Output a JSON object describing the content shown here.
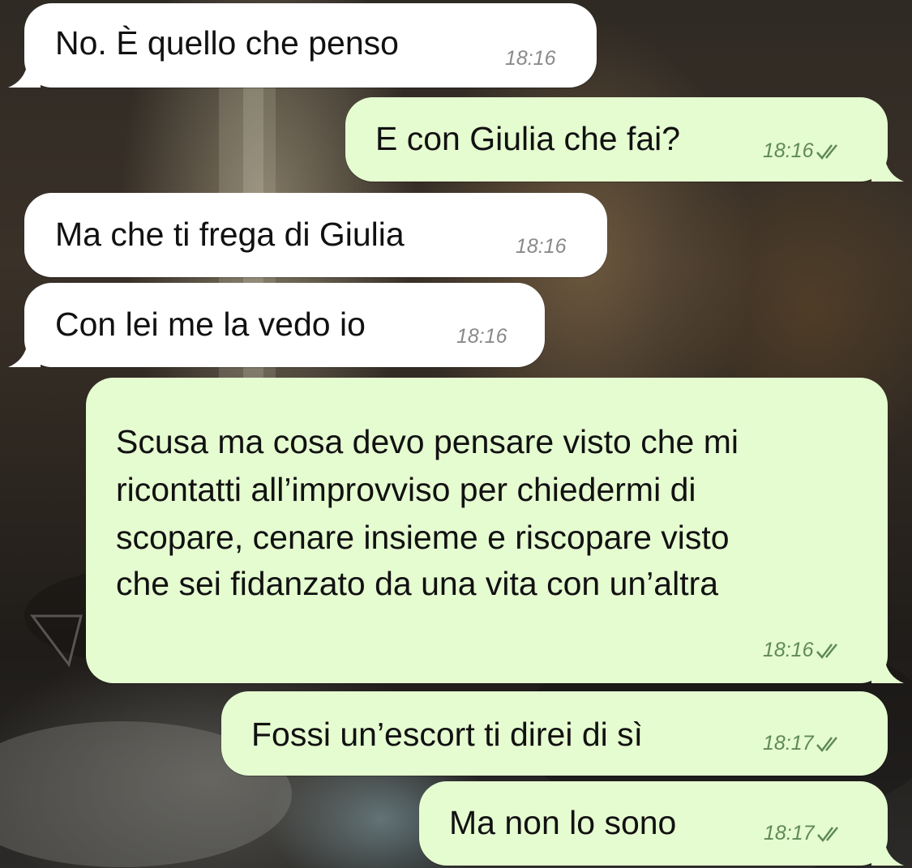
{
  "messages": [
    {
      "direction": "incoming",
      "text": "No. È quello che penso",
      "time": "18:16"
    },
    {
      "direction": "outgoing",
      "text": "E con Giulia che fai?",
      "time": "18:16",
      "status": "read-double-check-icon"
    },
    {
      "direction": "incoming",
      "text": "Ma che ti frega di Giulia",
      "time": "18:16"
    },
    {
      "direction": "incoming",
      "text": "Con lei me la vedo io",
      "time": "18:16"
    },
    {
      "direction": "outgoing",
      "lines": [
        "Scusa ma cosa devo pensare visto che mi",
        "ricontatti all’improvviso per chiedermi di",
        "scopare, cenare insieme e riscopare visto",
        "che sei fidanzato da una vita con un’altra"
      ],
      "time": "18:16",
      "status": "read-double-check-icon"
    },
    {
      "direction": "outgoing",
      "text": "Fossi un’escort ti direi di sì",
      "time": "18:17",
      "status": "read-double-check-icon"
    },
    {
      "direction": "outgoing",
      "text": "Ma non lo sono",
      "time": "18:17",
      "status": "read-double-check-icon"
    }
  ],
  "colors": {
    "incoming_bubble": "#ffffff",
    "outgoing_bubble": "#e5fbd0",
    "incoming_time": "#8a8a8a",
    "outgoing_time": "#5f8a55",
    "read_ticks": "#5f8a55"
  }
}
